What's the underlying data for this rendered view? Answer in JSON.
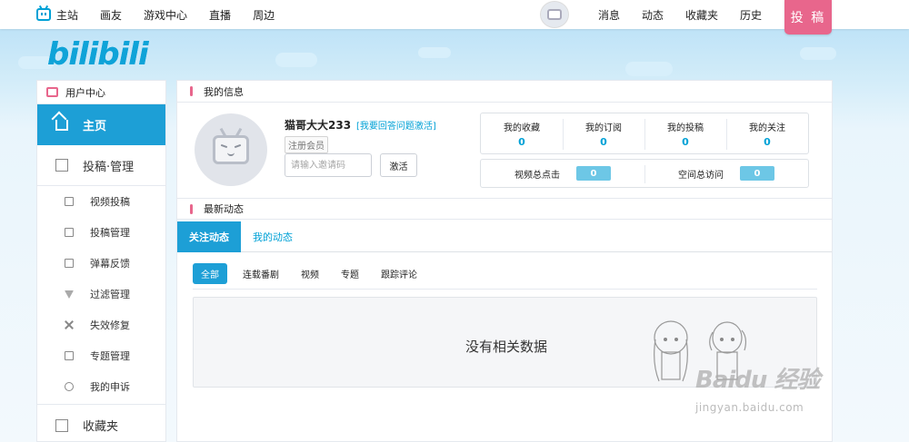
{
  "topnav": {
    "left_items": [
      "主站",
      "画友",
      "游戏中心",
      "直播",
      "周边"
    ],
    "right_items": [
      "消息",
      "动态",
      "收藏夹",
      "历史"
    ],
    "post_button": "投 稿"
  },
  "logo_text": "bilibili",
  "sidebar": {
    "header": "用户中心",
    "main": "主页",
    "section_upload": "投稿·管理",
    "sub_items": [
      "视频投稿",
      "投稿管理",
      "弹幕反馈",
      "过滤管理",
      "失效修复",
      "专题管理",
      "我的申诉"
    ],
    "section_favorites": "收藏夹"
  },
  "profile": {
    "section_title": "我的信息",
    "username": "猫哥大大233",
    "activate_link": "[我要回答问题激活]",
    "member_badge": "注册会员",
    "invite_placeholder": "请输入邀请码",
    "activate_button": "激活"
  },
  "stats": [
    {
      "label": "我的收藏",
      "value": "0"
    },
    {
      "label": "我的订阅",
      "value": "0"
    },
    {
      "label": "我的投稿",
      "value": "0"
    },
    {
      "label": "我的关注",
      "value": "0"
    }
  ],
  "stats2": [
    {
      "label": "视频总点击",
      "value": "0"
    },
    {
      "label": "空间总访问",
      "value": "0"
    }
  ],
  "feed": {
    "section_title": "最新动态",
    "tabs": [
      "关注动态",
      "我的动态"
    ],
    "filters": [
      "全部",
      "连载番剧",
      "视频",
      "专题",
      "跟踪评论"
    ],
    "empty_text": "没有相关数据"
  },
  "watermark": {
    "main": "Baidu 经验",
    "sub": "jingyan.baidu.com"
  },
  "colors": {
    "accent": "#00a1d6",
    "pink": "#e8668c",
    "active_tab": "#1d9fd6"
  }
}
